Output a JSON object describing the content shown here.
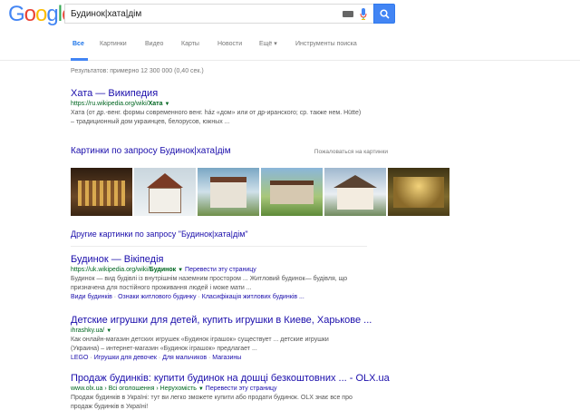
{
  "logo": {
    "letters": [
      "G",
      "o",
      "o",
      "g",
      "l",
      "e"
    ],
    "colors": [
      "#4285f4",
      "#ea4335",
      "#fbbc05",
      "#4285f4",
      "#34a853",
      "#ea4335"
    ]
  },
  "search": {
    "query": "Будинок|хата|дім"
  },
  "tabs": [
    {
      "label": "Все"
    },
    {
      "label": "Картинки"
    },
    {
      "label": "Видео"
    },
    {
      "label": "Карты"
    },
    {
      "label": "Новости"
    },
    {
      "label": "Ещё ▾"
    },
    {
      "label": "Инструменты поиска"
    }
  ],
  "stats": "Результатов: примерно 12 300 000 (0,40 сек.)",
  "results": [
    {
      "title": "Хата — Википедия",
      "url_pre": "https://ru.wikipedia.org/wiki/",
      "url_bold": "Хата",
      "snippet_1": "Хата (от др.-венг. формы современного венг. ház «дом» или от др-иранского; ср. также нем. Hütte)",
      "snippet_2": "– традиционный дом украинцев, белорусов, южных ..."
    },
    {
      "title": "Будинок — Вікіпедія",
      "url_pre": "https://uk.wikipedia.org/wiki/",
      "url_bold": "Будинок",
      "translate": "Перевести эту страницу",
      "snippet_1": "Будинок — вид будівлі із внутрішнім наземним простором ... Житловий будинок— будівля, що",
      "snippet_2": "призначена для постійного проживання людей і може мати ...",
      "links": [
        "Види будинків",
        "Ознаки житлового будинку",
        "Класифікація житлових будинків ..."
      ]
    },
    {
      "title": "Детские игрушки для детей, купить игрушки в Киеве, Харькове ...",
      "url_pre": "ihrashky.ua/",
      "snippet_1": "Как онлайн-магазин детских игрушек «Будинок іграшок» существует ... детские игрушки",
      "snippet_2": "(Украина) – интернет-магазин «Будинок іграшок» предлагает ...",
      "links": [
        "LEGO",
        "Игрушки для девочек",
        "Для мальчиков",
        "Магазины"
      ]
    },
    {
      "title": "Продаж будинків: купити будинок на дошці безкоштовних ... - OLX.ua",
      "url_pre": "www.olx.ua › Всі оголошення › Нерухомість",
      "translate": "Перевести эту страницу",
      "snippet_1": "Продаж будинків в Україні: тут ви легко зможете купити або продати будинок. OLX знає все про",
      "snippet_2": "продаж будинків в Україні!"
    }
  ],
  "images": {
    "heading": "Картинки по запросу Будинок|хата|дім",
    "report": "Пожаловаться на картинки",
    "more": "Другие картинки по запросу \"Будинок|хата|дім\"",
    "thumbs": [
      {
        "name": "thumb-1",
        "bg": "#5a3b22"
      },
      {
        "name": "thumb-2",
        "bg": "#dfe6ea"
      },
      {
        "name": "thumb-3",
        "bg": "#6a8ea6"
      },
      {
        "name": "thumb-4",
        "bg": "#7faa5c"
      },
      {
        "name": "thumb-5",
        "bg": "#8aa3b8"
      },
      {
        "name": "thumb-6",
        "bg": "#6b5a2a"
      }
    ]
  }
}
